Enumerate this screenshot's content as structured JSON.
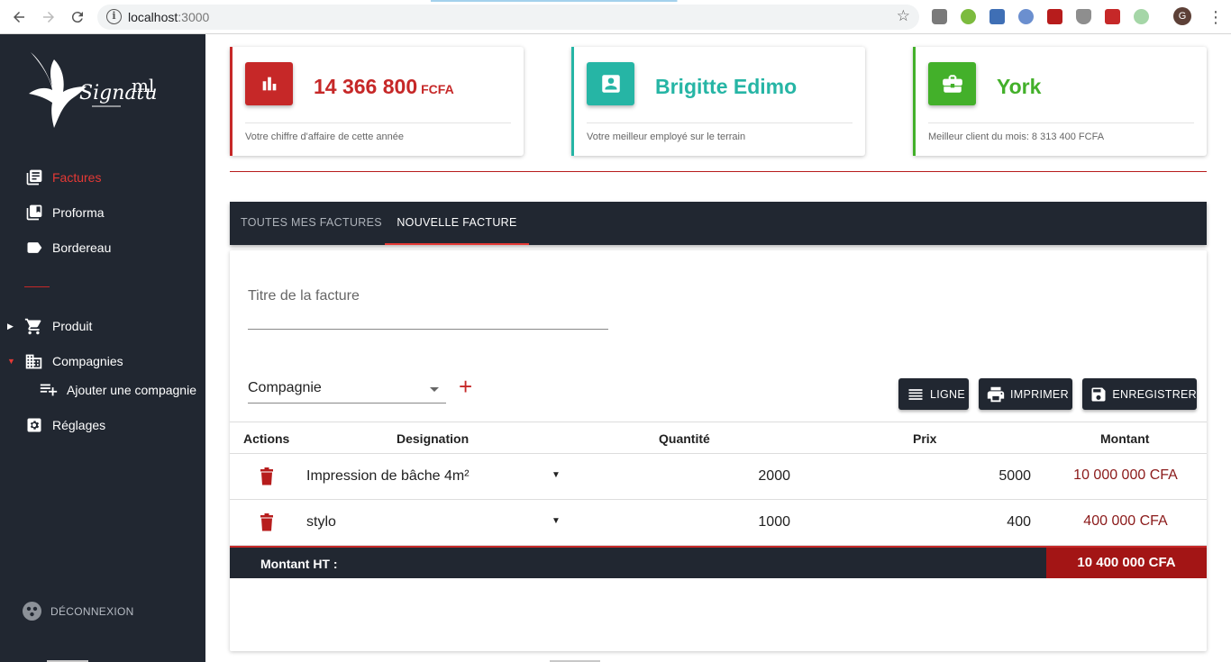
{
  "browser": {
    "url_host": "localhost",
    "url_port": ":3000",
    "avatar_letter": "G"
  },
  "sidebar": {
    "logo_text": "Signature ml",
    "items": [
      {
        "label": "Factures",
        "active": true
      },
      {
        "label": "Proforma"
      },
      {
        "label": "Bordereau"
      },
      {
        "label": "Produit"
      },
      {
        "label": "Compagnies"
      },
      {
        "label": "Réglages"
      }
    ],
    "sub_item": "Ajouter une compagnie",
    "logout": "DÉCONNEXION"
  },
  "cards": [
    {
      "value": "14 366 800",
      "unit": "FCFA",
      "caption": "Votre chiffre d'affaire de cette année",
      "color": "#c62828"
    },
    {
      "value": "Brigitte Edimo",
      "unit": "",
      "caption": "Votre meilleur employé sur le terrain",
      "color": "#26b5a5"
    },
    {
      "value": "York",
      "unit": "",
      "caption": "Meilleur client du mois: 8 313 400 FCFA",
      "color": "#43b02a"
    }
  ],
  "tabs": [
    "TOUTES MES FACTURES",
    "NOUVELLE FACTURE"
  ],
  "form": {
    "title_placeholder": "Titre de la facture",
    "company_select": "Compagnie"
  },
  "buttons": {
    "ligne": "LIGNE",
    "imprimer": "IMPRIMER",
    "enregistrer": "ENREGISTRER"
  },
  "table": {
    "headers": [
      "Actions",
      "Designation",
      "Quantité",
      "Prix",
      "Montant"
    ],
    "rows": [
      {
        "designation": "Impression de bâche 4m²",
        "quantite": "2000",
        "prix": "5000",
        "montant": "10 000 000 CFA"
      },
      {
        "designation": "stylo",
        "quantite": "1000",
        "prix": "400",
        "montant": "400 000 CFA"
      }
    ],
    "total_label": "Montant HT :",
    "total_value": "10 400 000 CFA"
  }
}
